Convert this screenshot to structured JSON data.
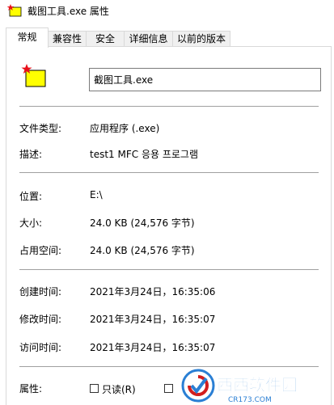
{
  "window": {
    "title": "截图工具.exe 属性"
  },
  "tabs": [
    {
      "label": "常规",
      "active": true
    },
    {
      "label": "兼容性",
      "active": false
    },
    {
      "label": "安全",
      "active": false
    },
    {
      "label": "详细信息",
      "active": false
    },
    {
      "label": "以前的版本",
      "active": false
    }
  ],
  "general": {
    "file_name": "截图工具.exe",
    "rows": {
      "type": {
        "label": "文件类型:",
        "value": "应用程序 (.exe)"
      },
      "description": {
        "label": "描述:",
        "value": "test1 MFC 응용 프로그램"
      },
      "location": {
        "label": "位置:",
        "value": "E:\\"
      },
      "size": {
        "label": "大小:",
        "value": "24.0 KB (24,576 字节)"
      },
      "size_on_disk": {
        "label": "占用空间:",
        "value": "24.0 KB (24,576 字节)"
      },
      "created": {
        "label": "创建时间:",
        "value": "2021年3月24日，16:35:06"
      },
      "modified": {
        "label": "修改时间:",
        "value": "2021年3月24日，16:35:07"
      },
      "accessed": {
        "label": "访问时间:",
        "value": "2021年3月24日，16:35:07"
      }
    },
    "attributes": {
      "label": "属性:",
      "readonly_label": "只读(R)",
      "readonly_checked": false,
      "hidden_checked": false
    }
  },
  "watermark": {
    "text": "西西软件园",
    "sub": "CR173.COM"
  },
  "colors": {
    "icon_yellow": "#ffff00",
    "icon_star": "#e8101a",
    "watermark_blue": "#2a7fd4",
    "watermark_red": "#d21d1d"
  }
}
